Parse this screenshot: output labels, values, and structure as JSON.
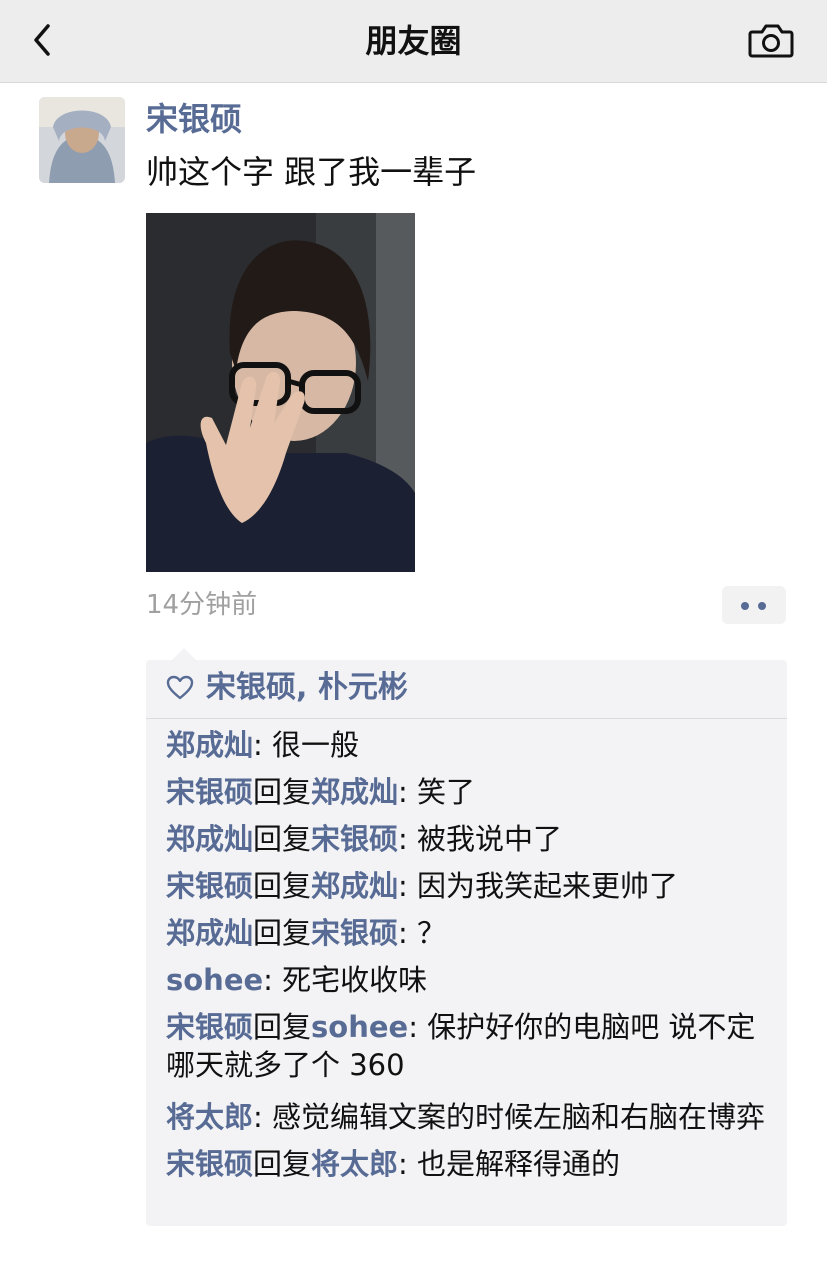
{
  "nav": {
    "title": "朋友圈"
  },
  "post": {
    "author": "宋银硕",
    "text": "帅这个字 跟了我一辈子",
    "time": "14分钟前"
  },
  "likes": {
    "names": "宋银硕, 朴元彬"
  },
  "comments": [
    {
      "from": "郑成灿",
      "to": "",
      "text": ": 很一般"
    },
    {
      "from": "宋银硕",
      "reply": "回复",
      "to": "郑成灿",
      "text": ": 笑了"
    },
    {
      "from": "郑成灿",
      "reply": "回复",
      "to": "宋银硕",
      "text": ": 被我说中了"
    },
    {
      "from": "宋银硕",
      "reply": "回复",
      "to": "郑成灿",
      "text": ": 因为我笑起来更帅了"
    },
    {
      "from": "郑成灿",
      "reply": "回复",
      "to": "宋银硕",
      "text": ": ？"
    },
    {
      "from": "sohee",
      "to": "",
      "text": ": 死宅收收味"
    },
    {
      "from": "宋银硕",
      "reply": "回复",
      "to": "sohee",
      "text": ": 保护好你的电脑吧 说不定哪天就多了个 360"
    },
    {
      "from": "将太郎",
      "to": "",
      "text": ": 感觉编辑文案的时候左脑和右脑在博弈"
    },
    {
      "from": "宋银硕",
      "reply": "回复",
      "to": "将太郎",
      "text": ": 也是解释得通的"
    }
  ],
  "colors": {
    "link": "#576b95",
    "panel": "#f3f3f5",
    "navbar": "#ededed"
  },
  "icons": [
    "back-arrow-icon",
    "camera-icon",
    "heart-icon",
    "more-dots-icon"
  ]
}
